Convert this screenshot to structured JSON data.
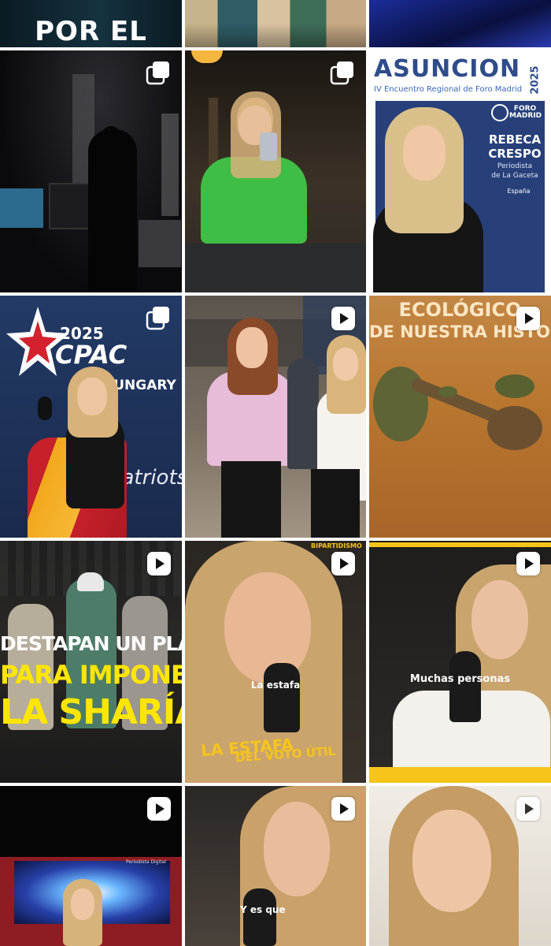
{
  "grid": {
    "tiles": [
      {
        "id": "t0",
        "badge": "none",
        "texts": {
          "caption": "POR EL"
        }
      },
      {
        "id": "t1",
        "badge": "none",
        "texts": {}
      },
      {
        "id": "t2",
        "badge": "none",
        "texts": {}
      },
      {
        "id": "t3",
        "badge": "carousel",
        "texts": {}
      },
      {
        "id": "t4",
        "badge": "carousel",
        "texts": {}
      },
      {
        "id": "t5",
        "badge": "none",
        "texts": {
          "title": "ASUNCION",
          "year": "2025",
          "subtitle": "IV Encuentro Regional de Foro Madrid",
          "org": "FORO MADRID",
          "name_first": "REBECA",
          "name_last": "CRESPO",
          "role_line1": "Periodista",
          "role_line2": "de La Gaceta",
          "country": "España"
        }
      },
      {
        "id": "t6",
        "badge": "carousel",
        "texts": {
          "year": "2025",
          "logo": "CPAC",
          "place": "HUNGARY",
          "script": "patriots"
        }
      },
      {
        "id": "t7",
        "badge": "reel",
        "texts": {}
      },
      {
        "id": "t8",
        "badge": "reel",
        "texts": {
          "line1": "ECOLÓGICO",
          "line2": "DE NUESTRA HISTORIA"
        }
      },
      {
        "id": "t9",
        "badge": "reel",
        "texts": {
          "line1": "DESTAPAN UN PLAN",
          "line2": "PARA IMPONER",
          "line3": "LA SHARÍA"
        }
      },
      {
        "id": "t10",
        "badge": "reel",
        "texts": {
          "tag": "BIPARTIDISMO",
          "subtitle": "La estafa",
          "line1": "LA ESTAFA",
          "line2": "DEL VOTO ÚTIL"
        }
      },
      {
        "id": "t11",
        "badge": "reel",
        "texts": {
          "subtitle": "Muchas personas"
        }
      },
      {
        "id": "t12",
        "badge": "reel",
        "texts": {
          "watermark": "Periodista Digital"
        }
      },
      {
        "id": "t13",
        "badge": "reel",
        "texts": {
          "subtitle": "Y es que"
        }
      },
      {
        "id": "t14",
        "badge": "reel",
        "texts": {}
      }
    ]
  },
  "colors": {
    "gaceta_yellow": "#f6c51a",
    "caption_yellow": "#ffe600",
    "foro_blue": "#27407a",
    "desert": "#b9762e"
  }
}
